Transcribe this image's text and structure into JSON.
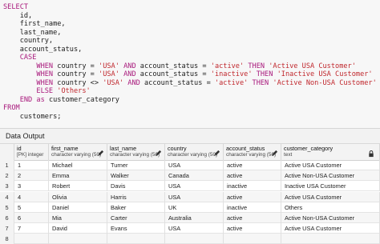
{
  "editor": {
    "lines": [
      [
        {
          "t": "SELECT",
          "k": "kw"
        }
      ],
      [
        {
          "t": "    id,",
          "k": ""
        }
      ],
      [
        {
          "t": "    first_name,",
          "k": ""
        }
      ],
      [
        {
          "t": "    last_name,",
          "k": ""
        }
      ],
      [
        {
          "t": "    country,",
          "k": ""
        }
      ],
      [
        {
          "t": "    account_status,",
          "k": ""
        }
      ],
      [
        {
          "t": "    ",
          "k": ""
        },
        {
          "t": "CASE",
          "k": "kw"
        }
      ],
      [
        {
          "t": "        ",
          "k": ""
        },
        {
          "t": "WHEN",
          "k": "kw"
        },
        {
          "t": " country = ",
          "k": ""
        },
        {
          "t": "'USA'",
          "k": "str"
        },
        {
          "t": " ",
          "k": ""
        },
        {
          "t": "AND",
          "k": "kw"
        },
        {
          "t": " account_status = ",
          "k": ""
        },
        {
          "t": "'active'",
          "k": "str"
        },
        {
          "t": " ",
          "k": ""
        },
        {
          "t": "THEN",
          "k": "kw"
        },
        {
          "t": " ",
          "k": ""
        },
        {
          "t": "'Active USA Customer'",
          "k": "str"
        }
      ],
      [
        {
          "t": "        ",
          "k": ""
        },
        {
          "t": "WHEN",
          "k": "kw"
        },
        {
          "t": " country = ",
          "k": ""
        },
        {
          "t": "'USA'",
          "k": "str"
        },
        {
          "t": " ",
          "k": ""
        },
        {
          "t": "AND",
          "k": "kw"
        },
        {
          "t": " account_status = ",
          "k": ""
        },
        {
          "t": "'inactive'",
          "k": "str"
        },
        {
          "t": " ",
          "k": ""
        },
        {
          "t": "THEN",
          "k": "kw"
        },
        {
          "t": " ",
          "k": ""
        },
        {
          "t": "'Inactive USA Customer'",
          "k": "str"
        }
      ],
      [
        {
          "t": "        ",
          "k": ""
        },
        {
          "t": "WHEN",
          "k": "kw"
        },
        {
          "t": " country <> ",
          "k": ""
        },
        {
          "t": "'USA'",
          "k": "str"
        },
        {
          "t": " ",
          "k": ""
        },
        {
          "t": "AND",
          "k": "kw"
        },
        {
          "t": " account_status = ",
          "k": ""
        },
        {
          "t": "'active'",
          "k": "str"
        },
        {
          "t": " ",
          "k": ""
        },
        {
          "t": "THEN",
          "k": "kw"
        },
        {
          "t": " ",
          "k": ""
        },
        {
          "t": "'Active Non-USA Customer'",
          "k": "str"
        }
      ],
      [
        {
          "t": "        ",
          "k": ""
        },
        {
          "t": "ELSE",
          "k": "kw"
        },
        {
          "t": " ",
          "k": ""
        },
        {
          "t": "'Others'",
          "k": "str"
        }
      ],
      [
        {
          "t": "    ",
          "k": ""
        },
        {
          "t": "END",
          "k": "kw"
        },
        {
          "t": " ",
          "k": ""
        },
        {
          "t": "as",
          "k": "kw"
        },
        {
          "t": " customer_category",
          "k": ""
        }
      ],
      [
        {
          "t": "FROM",
          "k": "kw"
        }
      ],
      [
        {
          "t": "    customers;",
          "k": ""
        }
      ]
    ]
  },
  "output_panel": {
    "title": "Data Output"
  },
  "columns": [
    {
      "name": "id",
      "type": "[PK] integer",
      "editable": false,
      "locked": false
    },
    {
      "name": "first_name",
      "type": "character varying (50)",
      "editable": true,
      "locked": false
    },
    {
      "name": "last_name",
      "type": "character varying (50)",
      "editable": true,
      "locked": false
    },
    {
      "name": "country",
      "type": "character varying (50)",
      "editable": true,
      "locked": false
    },
    {
      "name": "account_status",
      "type": "character varying (50)",
      "editable": true,
      "locked": false
    },
    {
      "name": "customer_category",
      "type": "text",
      "editable": false,
      "locked": true
    }
  ],
  "rows": [
    {
      "n": "1",
      "cells": [
        "1",
        "Michael",
        "Turner",
        "USA",
        "active",
        "Active USA Customer"
      ]
    },
    {
      "n": "2",
      "cells": [
        "2",
        "Emma",
        "Walker",
        "Canada",
        "active",
        "Active Non-USA Customer"
      ]
    },
    {
      "n": "3",
      "cells": [
        "3",
        "Robert",
        "Davis",
        "USA",
        "inactive",
        "Inactive USA Customer"
      ]
    },
    {
      "n": "4",
      "cells": [
        "4",
        "Olivia",
        "Harris",
        "USA",
        "active",
        "Active USA Customer"
      ]
    },
    {
      "n": "5",
      "cells": [
        "5",
        "Daniel",
        "Baker",
        "UK",
        "inactive",
        "Others"
      ]
    },
    {
      "n": "6",
      "cells": [
        "6",
        "Mia",
        "Carter",
        "Australia",
        "active",
        "Active Non-USA Customer"
      ]
    },
    {
      "n": "7",
      "cells": [
        "7",
        "David",
        "Evans",
        "USA",
        "active",
        "Active USA Customer"
      ]
    },
    {
      "n": "8",
      "cells": [
        "",
        "",
        "",
        "",
        "",
        ""
      ]
    }
  ],
  "colors": {
    "keyword": "#a8197c",
    "string": "#c0272d"
  },
  "icons": {
    "edit": "pencil-icon",
    "lock": "lock-icon"
  }
}
